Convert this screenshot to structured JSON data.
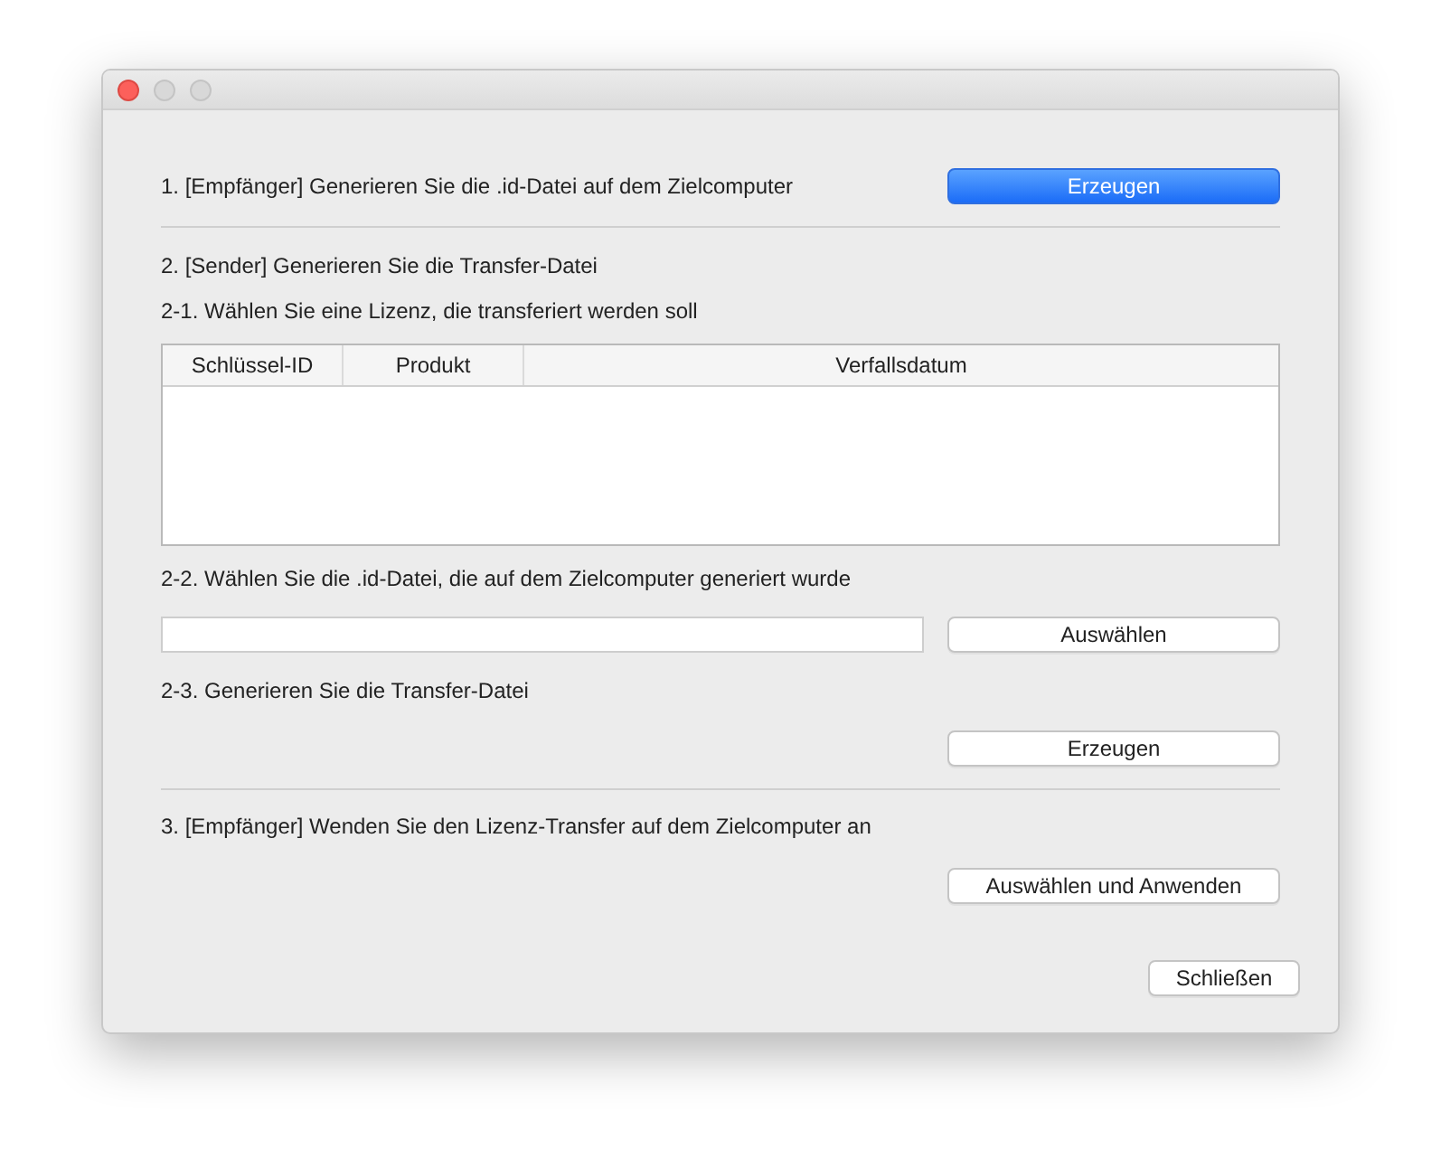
{
  "step1": {
    "label": "1. [Empfänger] Generieren Sie die .id-Datei auf dem Zielcomputer",
    "button": {
      "label": "Erzeugen",
      "primary": true
    }
  },
  "step2": {
    "label": "2. [Sender] Generieren Sie die Transfer-Datei"
  },
  "step2_1": {
    "label": "2-1. Wählen Sie eine Lizenz, die transferiert werden soll",
    "table": {
      "columns": [
        "Schlüssel-ID",
        "Produkt",
        "Verfallsdatum"
      ]
    }
  },
  "step2_2": {
    "label": "2-2. Wählen Sie die .id-Datei, die auf dem Zielcomputer generiert wurde",
    "button": {
      "label": "Auswählen",
      "primary": false
    }
  },
  "step2_3": {
    "label": "2-3. Generieren Sie die Transfer-Datei",
    "button": {
      "label": "Erzeugen",
      "primary": false
    }
  },
  "step3": {
    "label": "3. [Empfänger] Wenden Sie den Lizenz-Transfer auf dem Zielcomputer an",
    "button": {
      "label": "Auswählen und Anwenden",
      "primary": false
    }
  },
  "close_button": {
    "label": "Schließen",
    "primary": false
  }
}
